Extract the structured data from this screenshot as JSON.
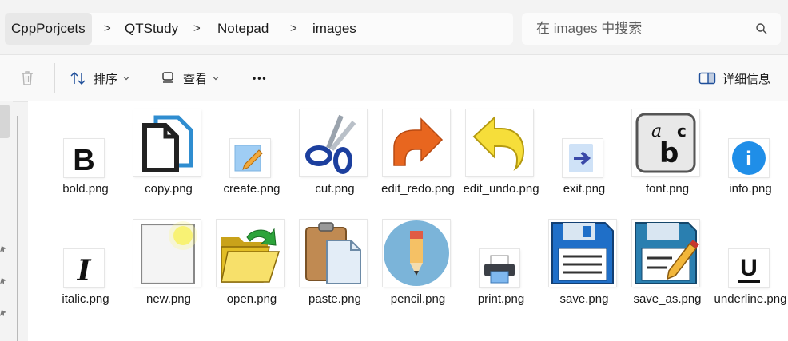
{
  "breadcrumb": {
    "items": [
      "CppPorjcets",
      "QTStudy",
      "Notepad",
      "images"
    ],
    "separator": ">"
  },
  "search": {
    "placeholder": "在 images 中搜索"
  },
  "toolbar": {
    "sort_label": "排序",
    "view_label": "查看",
    "more_label": "•••",
    "details_label": "详细信息"
  },
  "files": [
    {
      "name": "bold.png",
      "icon": "bold-icon"
    },
    {
      "name": "copy.png",
      "icon": "copy-icon"
    },
    {
      "name": "create.png",
      "icon": "create-icon"
    },
    {
      "name": "cut.png",
      "icon": "scissors-icon"
    },
    {
      "name": "edit_redo.png",
      "icon": "redo-arrow-icon"
    },
    {
      "name": "edit_undo.png",
      "icon": "undo-arrow-icon"
    },
    {
      "name": "exit.png",
      "icon": "exit-icon"
    },
    {
      "name": "font.png",
      "icon": "font-icon"
    },
    {
      "name": "info.png",
      "icon": "info-icon"
    },
    {
      "name": "italic.png",
      "icon": "italic-icon"
    },
    {
      "name": "new.png",
      "icon": "new-document-icon"
    },
    {
      "name": "open.png",
      "icon": "open-folder-icon"
    },
    {
      "name": "paste.png",
      "icon": "clipboard-icon"
    },
    {
      "name": "pencil.png",
      "icon": "pencil-icon"
    },
    {
      "name": "print.png",
      "icon": "printer-icon"
    },
    {
      "name": "save.png",
      "icon": "floppy-disk-icon"
    },
    {
      "name": "save_as.png",
      "icon": "save-as-icon"
    },
    {
      "name": "underline.png",
      "icon": "underline-icon"
    }
  ],
  "colors": {
    "accent_blue": "#2f6fd0",
    "orange": "#e8661f",
    "yellow": "#f0d000"
  }
}
